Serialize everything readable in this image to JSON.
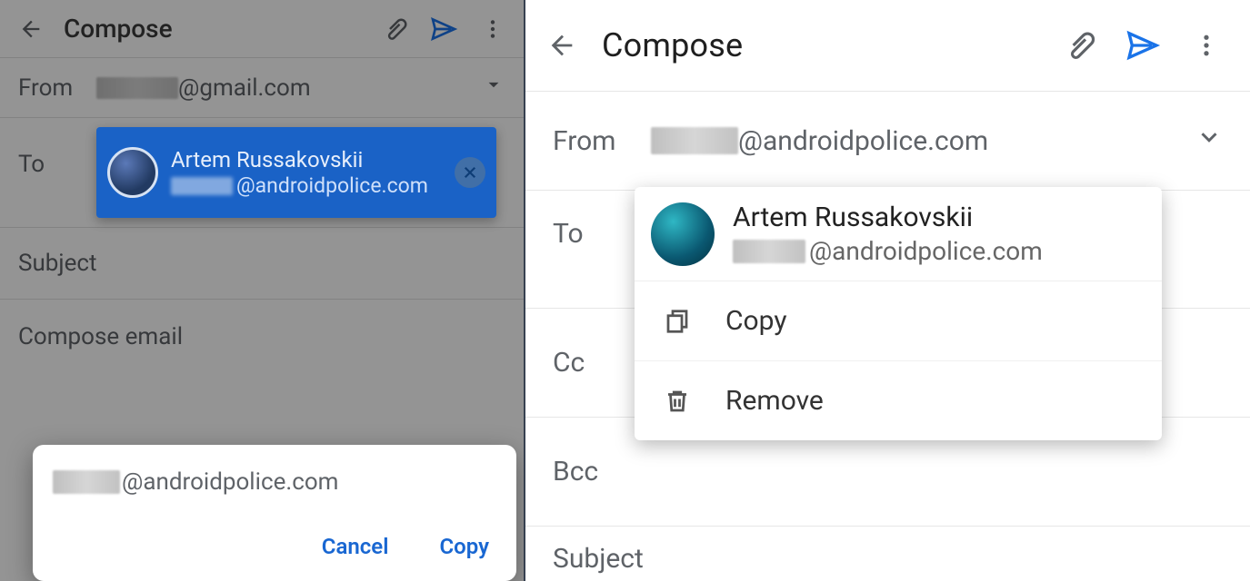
{
  "left": {
    "title": "Compose",
    "from_label": "From",
    "from_domain": "@gmail.com",
    "to_label": "To",
    "chip": {
      "name": "Artem Russakovskii",
      "email_domain": "@androidpolice.com"
    },
    "subject_placeholder": "Subject",
    "body_placeholder": "Compose email",
    "dialog": {
      "email_domain": "@androidpolice.com",
      "cancel": "Cancel",
      "copy": "Copy"
    }
  },
  "right": {
    "title": "Compose",
    "from_label": "From",
    "from_domain": "@androidpolice.com",
    "to_label": "To",
    "cc_label": "Cc",
    "bcc_label": "Bcc",
    "subject_placeholder": "Subject",
    "popup": {
      "name": "Artem Russakovskii",
      "email_domain": "@androidpolice.com",
      "copy": "Copy",
      "remove": "Remove"
    }
  }
}
